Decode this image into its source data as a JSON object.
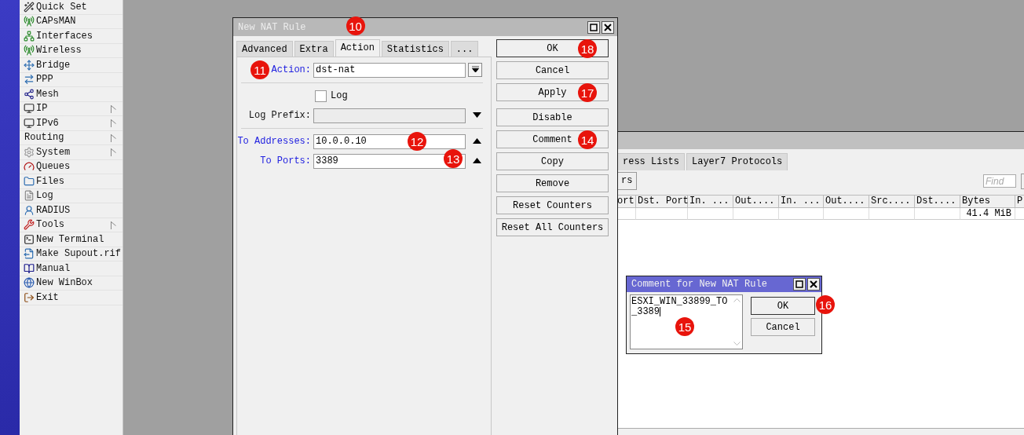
{
  "menu": {
    "items": [
      {
        "label": "Quick Set",
        "submenu": false
      },
      {
        "label": "CAPsMAN",
        "submenu": false
      },
      {
        "label": "Interfaces",
        "submenu": false
      },
      {
        "label": "Wireless",
        "submenu": false
      },
      {
        "label": "Bridge",
        "submenu": false
      },
      {
        "label": "PPP",
        "submenu": false
      },
      {
        "label": "Mesh",
        "submenu": false
      },
      {
        "label": "IP",
        "submenu": true
      },
      {
        "label": "IPv6",
        "submenu": true
      },
      {
        "label": "Routing",
        "submenu": true
      },
      {
        "label": "System",
        "submenu": true
      },
      {
        "label": "Queues",
        "submenu": false
      },
      {
        "label": "Files",
        "submenu": false
      },
      {
        "label": "Log",
        "submenu": false
      },
      {
        "label": "RADIUS",
        "submenu": false
      },
      {
        "label": "Tools",
        "submenu": true
      },
      {
        "label": "New Terminal",
        "submenu": false
      },
      {
        "label": "Make Supout.rif",
        "submenu": false
      },
      {
        "label": "Manual",
        "submenu": false
      },
      {
        "label": "New WinBox",
        "submenu": false
      },
      {
        "label": "Exit",
        "submenu": false
      }
    ]
  },
  "nat_list_window": {
    "tabs": [
      {
        "label": "ress Lists",
        "selected": false
      },
      {
        "label": "Layer7 Protocols",
        "selected": false
      }
    ],
    "toolbar_button": "rs",
    "search": {
      "placeholder": "Find"
    },
    "table": {
      "columns": [
        "ort",
        "Dst. Port",
        "In. ...",
        "Out....",
        "In. ...",
        "Out....",
        "Src....",
        "Dst....",
        "Bytes",
        "P"
      ],
      "rows": [
        {
          "cells": [
            "",
            "",
            "",
            "",
            "",
            "",
            "",
            "",
            "41.4 MiB",
            ""
          ]
        }
      ]
    }
  },
  "nat_rule_dialog": {
    "title": "New NAT Rule",
    "tabs": [
      {
        "label": "Advanced",
        "selected": false
      },
      {
        "label": "Extra",
        "selected": false
      },
      {
        "label": "Action",
        "selected": true,
        "badge": "10"
      },
      {
        "label": "Statistics",
        "selected": false
      },
      {
        "label": "...",
        "selected": false
      }
    ],
    "fields": [
      {
        "kind": "dropdown",
        "label": "Action:",
        "value": "dst-nat",
        "active": true,
        "badge": "11"
      },
      {
        "kind": "checkbox",
        "label": "Log",
        "checked": false
      },
      {
        "kind": "text",
        "label": "Log Prefix:",
        "active": false,
        "disabled": true,
        "expanded": false
      },
      {
        "kind": "text",
        "label": "To Addresses:",
        "value": "10.0.0.10",
        "active": true,
        "disabled": false,
        "expanded": true,
        "badge": "12"
      },
      {
        "kind": "text",
        "label": "To Ports:",
        "value": "3389",
        "active": true,
        "disabled": false,
        "expanded": true,
        "badge": "13"
      }
    ],
    "button_groups": [
      [
        {
          "label": "OK",
          "default": true,
          "badge": "18"
        },
        {
          "label": "Cancel",
          "default": false
        },
        {
          "label": "Apply",
          "default": false,
          "badge": "17"
        }
      ],
      [
        {
          "label": "Disable",
          "default": false
        },
        {
          "label": "Comment",
          "default": false,
          "badge": "14"
        },
        {
          "label": "Copy",
          "default": false
        },
        {
          "label": "Remove",
          "default": false
        },
        {
          "label": "Reset Counters",
          "default": false
        },
        {
          "label": "Reset All Counters",
          "default": false
        }
      ]
    ]
  },
  "comment_dialog": {
    "title": "Comment for New NAT Rule",
    "value": "ESXI_WIN_33899_TO_3389",
    "badge": "15",
    "buttons": [
      {
        "label": "OK",
        "default": true,
        "badge": "16"
      },
      {
        "label": "Cancel",
        "default": false
      }
    ]
  }
}
